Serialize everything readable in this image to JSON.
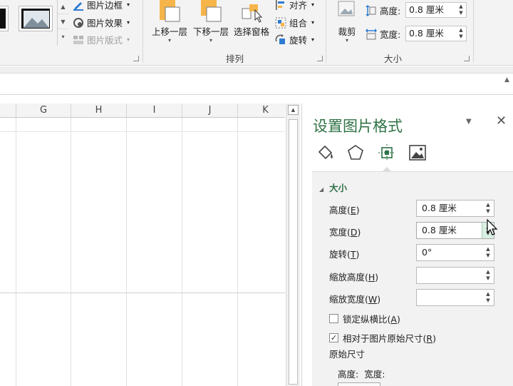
{
  "ribbon": {
    "picture_styles": {
      "border_label": "图片边框",
      "effects_label": "图片效果",
      "layout_label": "图片版式"
    },
    "arrange": {
      "bring_forward_label": "上移一层",
      "send_backward_label": "下移一层",
      "selection_pane_label": "选择窗格",
      "align_label": "对齐",
      "group_label": "组合",
      "rotate_label": "旋转",
      "group_title": "排列"
    },
    "size": {
      "crop_label": "裁剪",
      "height_label": "高度:",
      "height_value": "0.8 厘米",
      "width_label": "宽度:",
      "width_value": "0.8 厘米",
      "group_title": "大小"
    }
  },
  "sheet": {
    "columns": [
      "G",
      "H",
      "I",
      "J",
      "K"
    ]
  },
  "pane": {
    "title": "设置图片格式",
    "section_title": "大小",
    "height": {
      "label": "高度(",
      "key": "E",
      "close": ")",
      "value": "0.8 厘米"
    },
    "width": {
      "label": "宽度(",
      "key": "D",
      "close": ")",
      "value": "0.8 厘米"
    },
    "rotation": {
      "label": "旋转(",
      "key": "T",
      "close": ")",
      "value": "0°"
    },
    "scale_height": {
      "label": "缩放高度(",
      "key": "H",
      "close": ")",
      "value": ""
    },
    "scale_width": {
      "label": "缩放宽度(",
      "key": "W",
      "close": ")",
      "value": ""
    },
    "lock_aspect": {
      "label": "锁定纵横比(",
      "key": "A",
      "close": ")",
      "checked": false
    },
    "relative_original": {
      "label": "相对于图片原始尺寸(",
      "key": "R",
      "close": ")",
      "checked": true
    },
    "original_size_title": "原始尺寸",
    "original_height_label": "高度:",
    "original_width_label": "宽度:"
  },
  "colors": {
    "accent_green": "#2f7246",
    "ribbon_bg": "#f3f3f3",
    "pane_body_bg": "#f2f2f2",
    "icon_orange": "#f5b54a"
  }
}
